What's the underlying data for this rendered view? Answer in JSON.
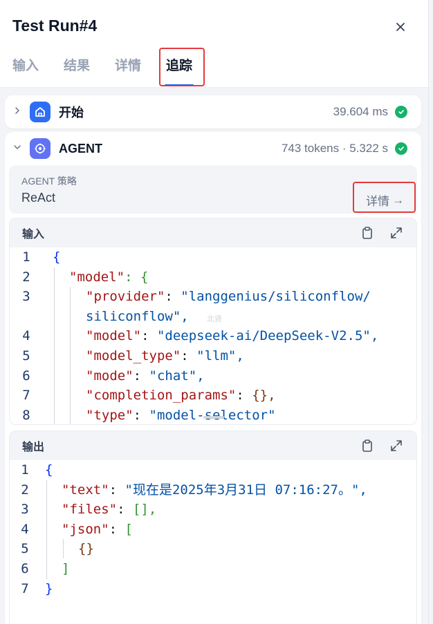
{
  "header": {
    "title": "Test Run#4",
    "tabs": [
      {
        "label": "输入",
        "active": false
      },
      {
        "label": "结果",
        "active": false
      },
      {
        "label": "详情",
        "active": false
      },
      {
        "label": "追踪",
        "active": true
      }
    ]
  },
  "nodes": {
    "start": {
      "name": "开始",
      "meta": "39.604 ms",
      "status": "success"
    },
    "agent": {
      "name": "AGENT",
      "meta": "743 tokens · 5.322 s",
      "status": "success"
    }
  },
  "strategy": {
    "label": "AGENT 策略",
    "value": "ReAct",
    "detail_label": "详情",
    "detail_arrow": "→"
  },
  "input_panel": {
    "title": "输入",
    "watermark": "北贤",
    "lines": [
      {
        "n": "1",
        "text": "{"
      },
      {
        "n": "2",
        "key": "\"model\"",
        "text": ": {"
      },
      {
        "n": "3",
        "key": "\"provider\"",
        "value": "\"langgenius/siliconflow/"
      },
      {
        "n": "",
        "value": "siliconflow\","
      },
      {
        "n": "4",
        "key": "\"model\"",
        "value": "\"deepseek-ai/DeepSeek-V2.5\","
      },
      {
        "n": "5",
        "key": "\"model_type\"",
        "value": "\"llm\","
      },
      {
        "n": "6",
        "key": "\"mode\"",
        "value": "\"chat\","
      },
      {
        "n": "7",
        "key": "\"completion_params\"",
        "value": "{},"
      },
      {
        "n": "8",
        "key": "\"type\"",
        "value": "\"model-selector\""
      }
    ]
  },
  "output_panel": {
    "title": "输出",
    "lines": [
      {
        "n": "1",
        "text": "{"
      },
      {
        "n": "2",
        "key": "\"text\"",
        "value": "\"现在是2025年3月31日 07:16:27。\","
      },
      {
        "n": "3",
        "key": "\"files\"",
        "value": "[],"
      },
      {
        "n": "4",
        "key": "\"json\"",
        "value": "["
      },
      {
        "n": "5",
        "text": "{}"
      },
      {
        "n": "6",
        "text": "]"
      },
      {
        "n": "7",
        "text": "}"
      }
    ]
  },
  "colors": {
    "accent": "#155eef",
    "success": "#17b26a",
    "highlight_box": "#e5393b",
    "start_icon_bg": "#2e6ef6",
    "agent_icon_bg": "#6172f3"
  }
}
